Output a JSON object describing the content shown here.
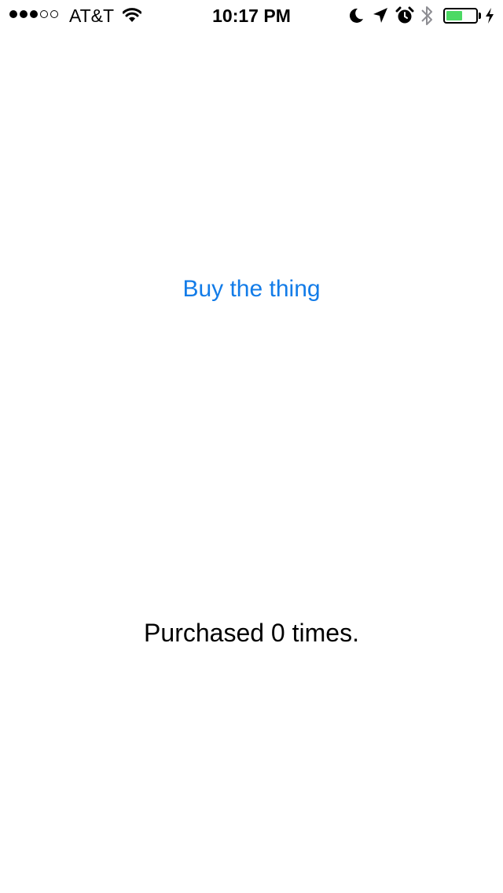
{
  "status_bar": {
    "carrier": "AT&T",
    "time": "10:17 PM",
    "signal_bars_filled": 3,
    "signal_bars_total": 5,
    "battery_level": 0.55,
    "battery_color": "#4cd964",
    "icons": [
      "wifi-icon",
      "moon-icon",
      "location-arrow-icon",
      "alarm-icon",
      "bluetooth-icon",
      "battery-icon",
      "charging-bolt-icon"
    ]
  },
  "main": {
    "buy_button_label": "Buy the thing",
    "purchase_count_label": "Purchased 0 times.",
    "accent_color": "#137ce8"
  }
}
